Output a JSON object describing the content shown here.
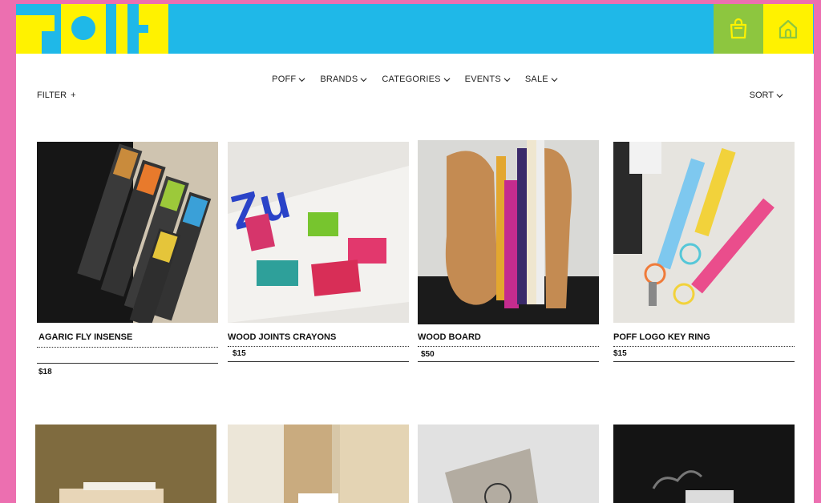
{
  "header": {
    "logo_alt": "POFF",
    "bag_icon": "shopping-bag-icon",
    "home_icon": "home-icon",
    "colors": {
      "bar": "#1fb8e8",
      "bag": "#8dc63f",
      "home": "#fff200",
      "frame": "#ec6fb0"
    }
  },
  "nav": {
    "items": [
      {
        "label": "POFF"
      },
      {
        "label": "BRANDS"
      },
      {
        "label": "CATEGORIES"
      },
      {
        "label": "EVENTS"
      },
      {
        "label": "SALE"
      }
    ]
  },
  "toolbar": {
    "filter_label": "FILTER",
    "filter_symbol": "+",
    "sort_label": "SORT"
  },
  "products": [
    {
      "name": "AGARIC FLY INSENSE",
      "price": "$18"
    },
    {
      "name": "WOOD JOINTS CRAYONS",
      "price": "$15"
    },
    {
      "name": "WOOD BOARD",
      "price": "$50"
    },
    {
      "name": "POFF LOGO KEY RING",
      "price": "$15"
    }
  ]
}
